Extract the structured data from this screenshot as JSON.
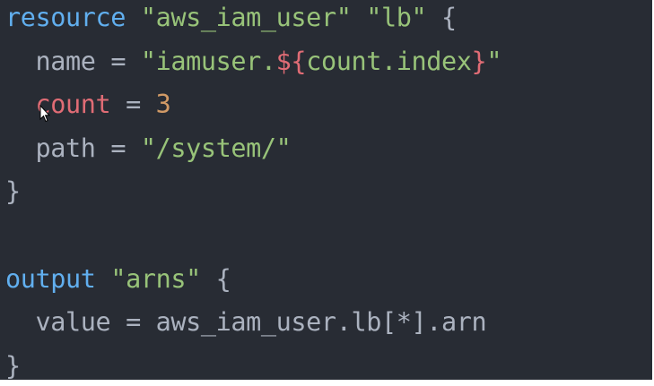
{
  "editor": {
    "lines": [
      {
        "tokens": [
          {
            "text": "resource",
            "type": "keyword"
          },
          {
            "text": " ",
            "type": "ident"
          },
          {
            "text": "\"aws_iam_user\"",
            "type": "string"
          },
          {
            "text": " ",
            "type": "ident"
          },
          {
            "text": "\"lb\"",
            "type": "string"
          },
          {
            "text": " ",
            "type": "ident"
          },
          {
            "text": "{",
            "type": "brace"
          }
        ]
      },
      {
        "tokens": [
          {
            "text": "  name",
            "type": "ident"
          },
          {
            "text": " = ",
            "type": "op"
          },
          {
            "text": "\"iamuser.",
            "type": "string"
          },
          {
            "text": "${",
            "type": "interp"
          },
          {
            "text": "count.index",
            "type": "string"
          },
          {
            "text": "}",
            "type": "interp"
          },
          {
            "text": "\"",
            "type": "string"
          }
        ]
      },
      {
        "tokens": [
          {
            "text": "  count",
            "type": "count"
          },
          {
            "text": " = ",
            "type": "op"
          },
          {
            "text": "3",
            "type": "num"
          }
        ]
      },
      {
        "tokens": [
          {
            "text": "  path",
            "type": "ident"
          },
          {
            "text": " = ",
            "type": "op"
          },
          {
            "text": "\"/system/\"",
            "type": "string"
          }
        ]
      },
      {
        "tokens": [
          {
            "text": "}",
            "type": "brace"
          }
        ]
      },
      {
        "tokens": []
      },
      {
        "tokens": [
          {
            "text": "output",
            "type": "keyword"
          },
          {
            "text": " ",
            "type": "ident"
          },
          {
            "text": "\"arns\"",
            "type": "string"
          },
          {
            "text": " ",
            "type": "ident"
          },
          {
            "text": "{",
            "type": "brace"
          }
        ]
      },
      {
        "tokens": [
          {
            "text": "  value",
            "type": "ident"
          },
          {
            "text": " = ",
            "type": "op"
          },
          {
            "text": "aws_iam_user.lb[*].arn",
            "type": "ident"
          }
        ]
      },
      {
        "tokens": [
          {
            "text": "}",
            "type": "brace"
          }
        ]
      }
    ]
  },
  "colors": {
    "background": "#282c34",
    "keyword": "#61afef",
    "string": "#98c379",
    "identifier": "#abb2bf",
    "number": "#d19a66",
    "interpolation": "#e06c75"
  },
  "cursor": {
    "icon": "mouse-pointer-icon"
  }
}
